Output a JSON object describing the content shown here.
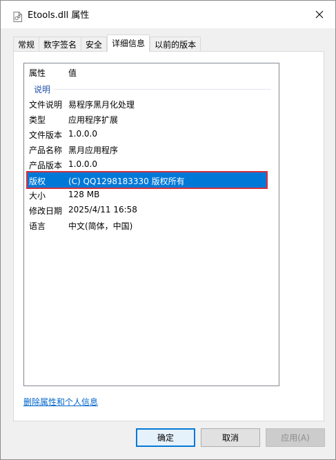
{
  "window": {
    "title": "Etools.dll 属性",
    "close_icon": "close-icon"
  },
  "tabs": [
    {
      "label": "常规",
      "active": false
    },
    {
      "label": "数字签名",
      "active": false
    },
    {
      "label": "安全",
      "active": false
    },
    {
      "label": "详细信息",
      "active": true
    },
    {
      "label": "以前的版本",
      "active": false
    }
  ],
  "details": {
    "columns": {
      "property": "属性",
      "value": "值"
    },
    "group": "说明",
    "rows": [
      {
        "key": "文件说明",
        "value": "易程序黑月化处理"
      },
      {
        "key": "类型",
        "value": "应用程序扩展"
      },
      {
        "key": "文件版本",
        "value": "1.0.0.0"
      },
      {
        "key": "产品名称",
        "value": "黑月应用程序"
      },
      {
        "key": "产品版本",
        "value": "1.0.0.0"
      },
      {
        "key": "版权",
        "value": "(C) QQ1298183330 版权所有",
        "selected": true
      },
      {
        "key": "大小",
        "value": "128 MB"
      },
      {
        "key": "修改日期",
        "value": "2025/4/11 16:58"
      },
      {
        "key": "语言",
        "value": "中文(简体，中国)"
      }
    ]
  },
  "remove_link": "删除属性和个人信息",
  "buttons": {
    "ok": "确定",
    "cancel": "取消",
    "apply": "应用(A)"
  },
  "colors": {
    "selection": "#0078d7",
    "selection_outline": "#d8303c",
    "link": "#0066cc"
  }
}
